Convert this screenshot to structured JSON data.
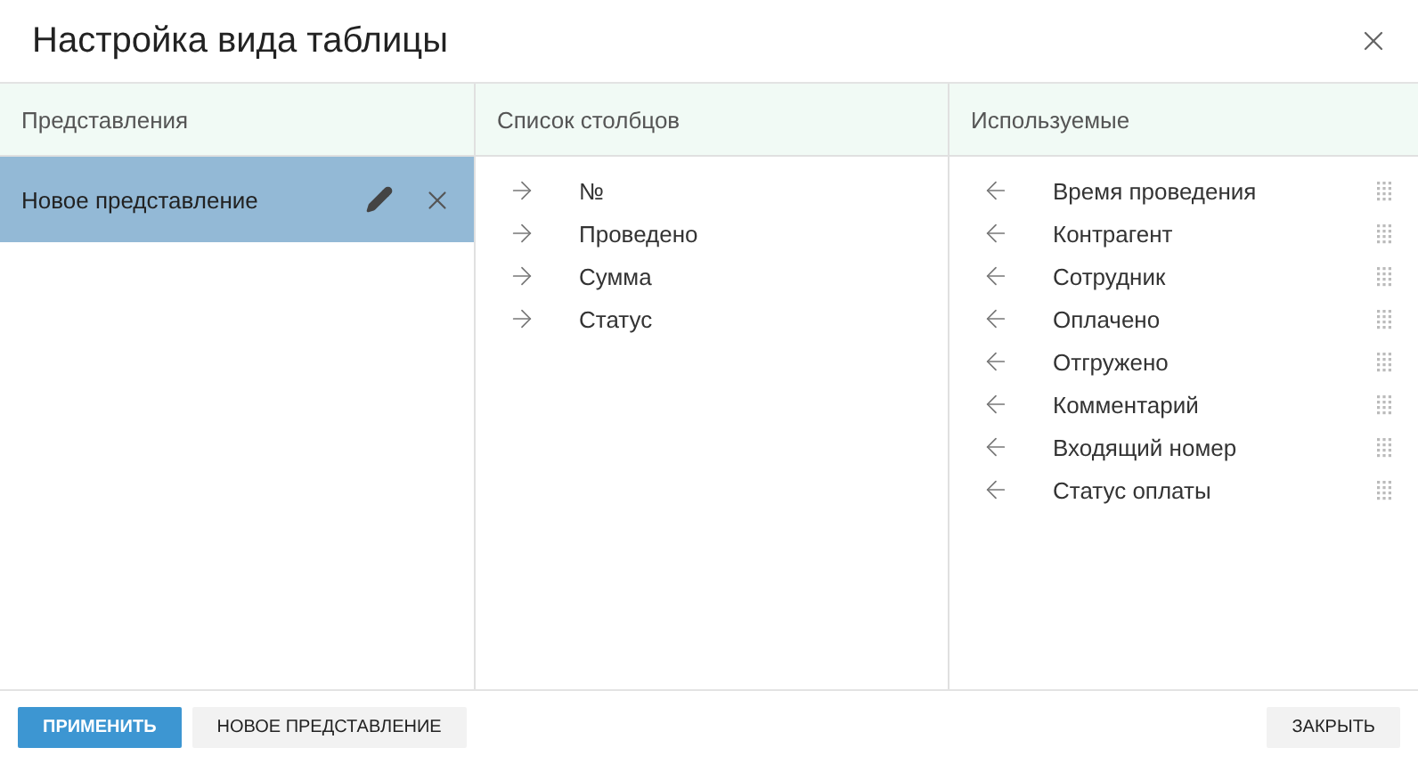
{
  "dialog": {
    "title": "Настройка вида таблицы"
  },
  "views": {
    "heading": "Представления",
    "items": [
      {
        "label": "Новое представление",
        "selected": true
      }
    ]
  },
  "available": {
    "heading": "Список столбцов",
    "items": [
      "№",
      "Проведено",
      "Сумма",
      "Статус"
    ]
  },
  "used": {
    "heading": "Используемые",
    "items": [
      "Время проведения",
      "Контрагент",
      "Сотрудник",
      "Оплачено",
      "Отгружено",
      "Комментарий",
      "Входящий номер",
      "Статус оплаты"
    ]
  },
  "buttons": [
    {
      "label": "ПРИМЕНИТЬ",
      "kind": "primary"
    },
    {
      "label": "НОВОЕ ПРЕДСТАВЛЕНИЕ",
      "kind": "secondary"
    },
    {
      "label": "ЗАКРЫТЬ",
      "kind": "close"
    }
  ]
}
